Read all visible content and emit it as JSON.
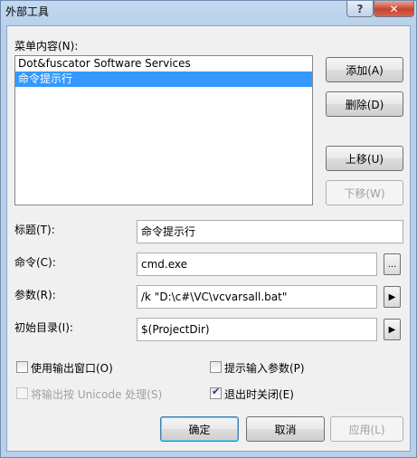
{
  "window": {
    "title": "外部工具",
    "help_glyph": "?",
    "close_glyph": "✕"
  },
  "menu_contents": {
    "label": "菜单内容(N):",
    "items": [
      {
        "label": "Dot&fuscator Software Services",
        "selected": false
      },
      {
        "label": "命令提示行",
        "selected": true
      }
    ]
  },
  "side_buttons": {
    "add": "添加(A)",
    "delete": "删除(D)",
    "move_up": "上移(U)",
    "move_down": "下移(W)"
  },
  "fields": {
    "title": {
      "label": "标题(T):",
      "value": "命令提示行"
    },
    "command": {
      "label": "命令(C):",
      "value": "cmd.exe",
      "browse": "..."
    },
    "arguments": {
      "label": "参数(R):",
      "value": "/k \"D:\\c#\\VC\\vcvarsall.bat\""
    },
    "initial_dir": {
      "label": "初始目录(I):",
      "value": "$(ProjectDir)"
    }
  },
  "options": {
    "use_output_window": {
      "label": "使用输出窗口(O)",
      "checked": false
    },
    "prompt_for_arguments": {
      "label": "提示输入参数(P)",
      "checked": false
    },
    "treat_output_as_unicode": {
      "label": "将输出按 Unicode 处理(S)",
      "checked": false,
      "disabled": true
    },
    "close_on_exit": {
      "label": "退出时关闭(E)",
      "checked": true
    }
  },
  "footer": {
    "ok": "确定",
    "cancel": "取消",
    "apply": "应用(L)"
  }
}
